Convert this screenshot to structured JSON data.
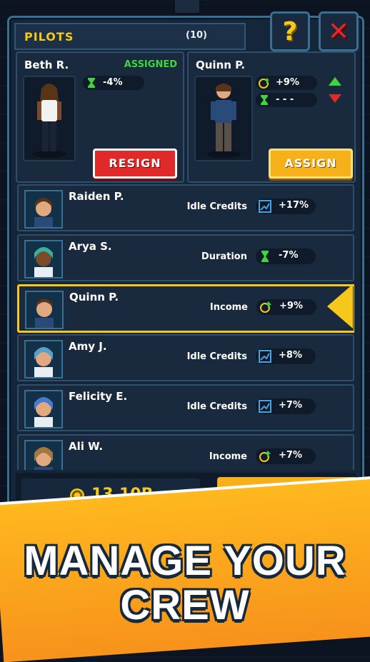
{
  "header": {
    "title": "PILOTS",
    "count": "(10)"
  },
  "top_buttons": {
    "help": "?",
    "close": "✕"
  },
  "current": {
    "name": "Beth R.",
    "status": "ASSIGNED",
    "stat": "-4%",
    "button": "RESIGN"
  },
  "candidate": {
    "name": "Quinn P.",
    "stat1": "+9%",
    "stat2": "- - -",
    "button": "ASSIGN"
  },
  "pilots": [
    {
      "name": "Raiden P.",
      "label": "Idle Credits",
      "value": "+17%",
      "icon": "chart-icon"
    },
    {
      "name": "Arya S.",
      "label": "Duration",
      "value": "-7%",
      "icon": "hourglass-icon"
    },
    {
      "name": "Quinn P.",
      "label": "Income",
      "value": "+9%",
      "icon": "coin-up-icon"
    },
    {
      "name": "Amy J.",
      "label": "Idle Credits",
      "value": "+8%",
      "icon": "chart-icon"
    },
    {
      "name": "Felicity E.",
      "label": "Idle Credits",
      "value": "+7%",
      "icon": "chart-icon"
    },
    {
      "name": "Ali W.",
      "label": "Income",
      "value": "+7%",
      "icon": "coin-up-icon"
    }
  ],
  "credits": "13,10B",
  "banner": {
    "line1": "MANAGE YOUR",
    "line2": "CREW"
  },
  "colors": {
    "accent": "#f6c81c",
    "assigned": "#3ed63a",
    "resign": "#e02a2a",
    "assign": "#f6b01a"
  }
}
